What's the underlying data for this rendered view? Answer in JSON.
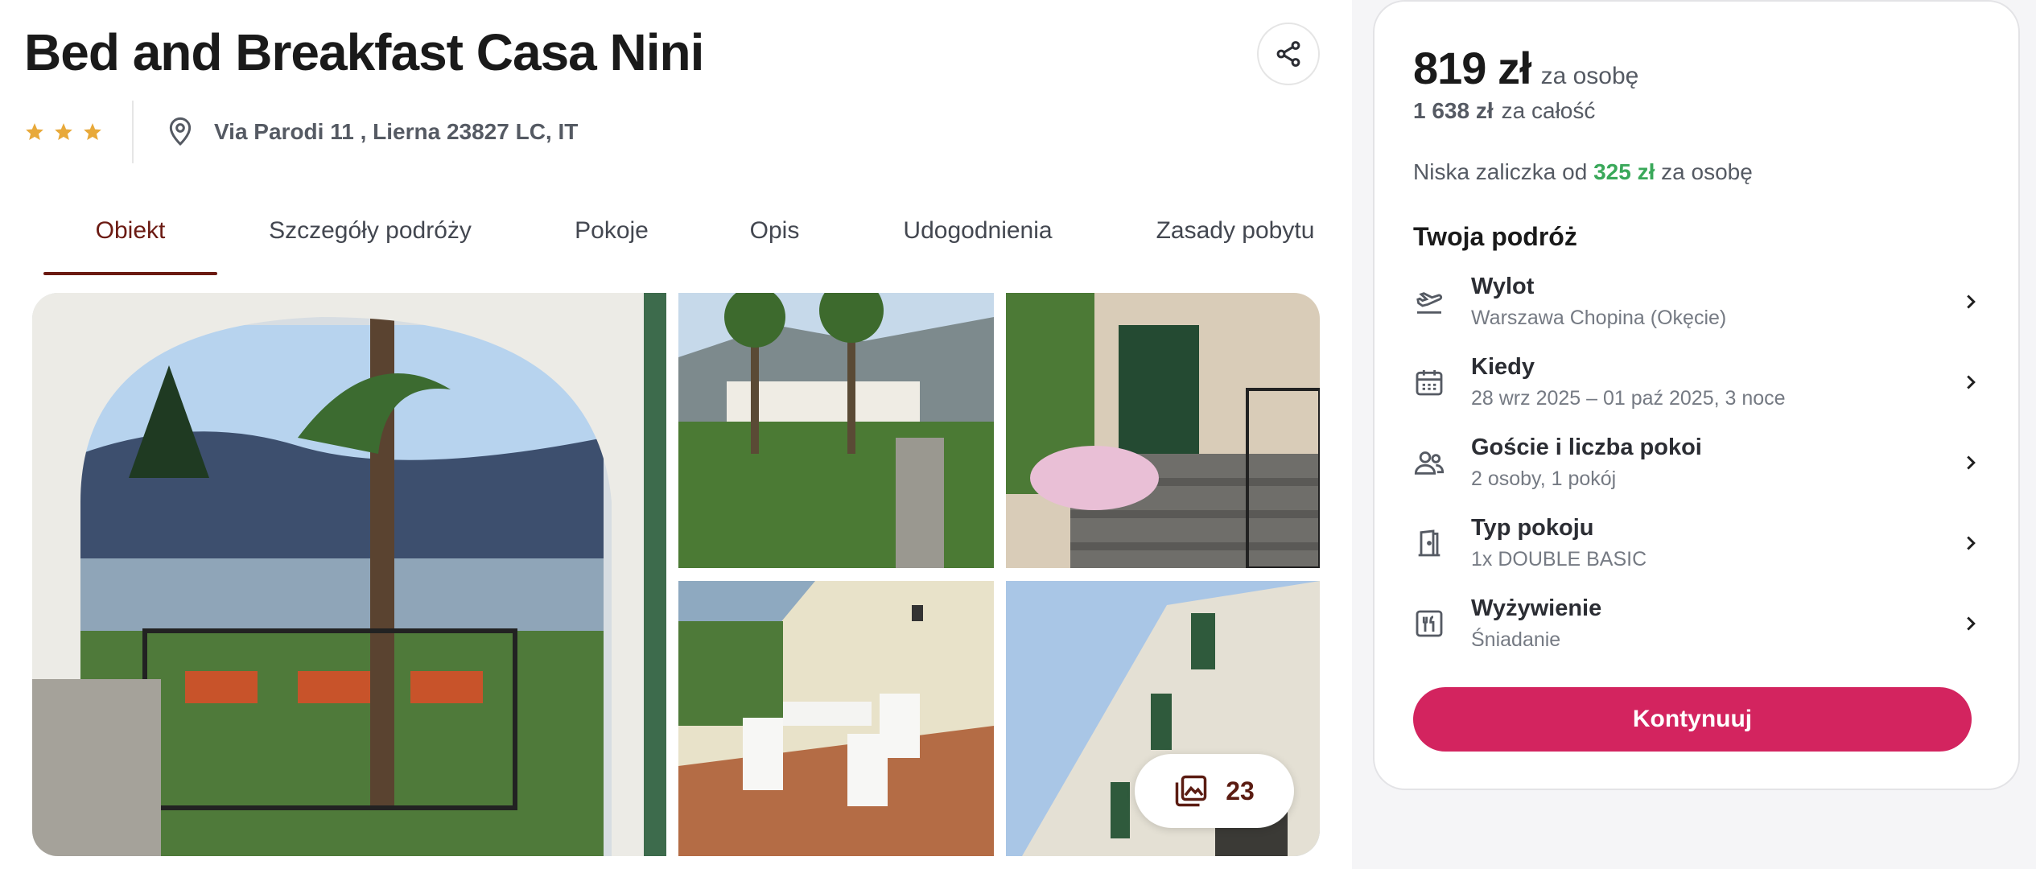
{
  "hotel": {
    "name": "Bed and Breakfast Casa Nini",
    "stars": 3,
    "address": "Via Parodi 11 , Lierna 23827 LC, IT"
  },
  "tabs": [
    {
      "label": "Obiekt",
      "active": true
    },
    {
      "label": "Szczegóły podróży",
      "active": false
    },
    {
      "label": "Pokoje",
      "active": false
    },
    {
      "label": "Opis",
      "active": false
    },
    {
      "label": "Udogodnienia",
      "active": false
    },
    {
      "label": "Zasady pobytu",
      "active": false
    }
  ],
  "gallery": {
    "photo_count": "23",
    "photos": [
      "arch-terrace-lake-view",
      "villa-garden-palms",
      "front-entrance-stairs",
      "balcony-table-chairs",
      "building-facade"
    ]
  },
  "booking": {
    "price_per_person": "819 zł",
    "price_per_person_label": "za osobę",
    "price_total": "1 638 zł",
    "price_total_label": "za całość",
    "deposit_prefix": "Niska zaliczka od",
    "deposit_amount": "325 zł",
    "deposit_suffix": "za osobę",
    "trip_title": "Twoja podróż",
    "trip_items": [
      {
        "label": "Wylot",
        "value": "Warszawa Chopina (Okęcie)",
        "icon": "plane-departure-icon"
      },
      {
        "label": "Kiedy",
        "value": "28 wrz 2025 – 01 paź 2025, 3 noce",
        "icon": "calendar-icon"
      },
      {
        "label": "Goście i liczba pokoi",
        "value": "2 osoby, 1 pokój",
        "icon": "guests-icon"
      },
      {
        "label": "Typ pokoju",
        "value": "1x DOUBLE BASIC",
        "icon": "door-icon"
      },
      {
        "label": "Wyżywienie",
        "value": "Śniadanie",
        "icon": "cutlery-icon"
      }
    ],
    "continue_label": "Kontynuuj"
  },
  "colors": {
    "accent": "#d3245f",
    "tab_active": "#6b1a12",
    "deposit_green": "#3aa85a",
    "star": "#e8a93a"
  }
}
